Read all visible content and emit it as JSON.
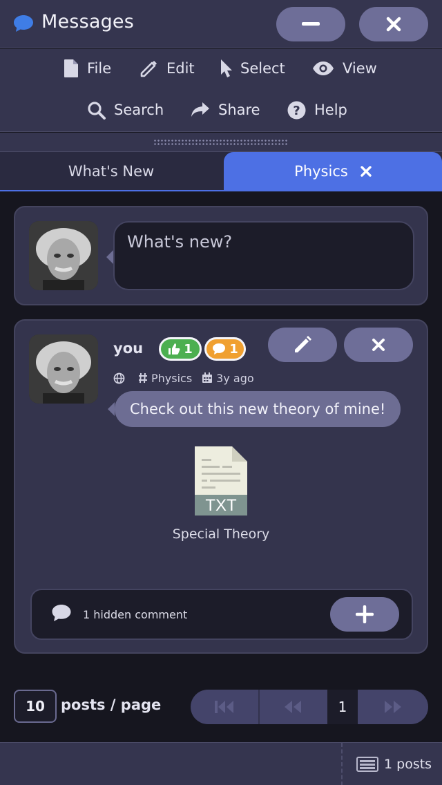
{
  "window": {
    "title": "Messages",
    "minimize_icon": "minus-icon",
    "close_icon": "close-icon"
  },
  "menu": [
    {
      "label": "File",
      "icon": "file-icon"
    },
    {
      "label": "Edit",
      "icon": "pencil-icon"
    },
    {
      "label": "Select",
      "icon": "cursor-icon"
    },
    {
      "label": "View",
      "icon": "eye-icon"
    },
    {
      "label": "Search",
      "icon": "search-icon"
    },
    {
      "label": "Share",
      "icon": "share-icon"
    },
    {
      "label": "Help",
      "icon": "help-icon"
    }
  ],
  "tabs": [
    {
      "label": "What's New",
      "active": false
    },
    {
      "label": "Physics",
      "active": true,
      "closable": true
    }
  ],
  "compose": {
    "placeholder": "What's new?"
  },
  "post": {
    "author": "you",
    "likes": "1",
    "comments_count": "1",
    "visibility_icon": "globe-icon",
    "channel": "Physics",
    "time": "3y ago",
    "message": "Check out this new theory of mine!",
    "attachment": {
      "type_label": "TXT",
      "name": "Special Theory"
    },
    "hidden_comments": "1 hidden comment"
  },
  "pagination": {
    "per_page": "10",
    "per_page_label": "posts / page",
    "current_page": "1"
  },
  "footer": {
    "count": "1 posts"
  },
  "colors": {
    "accent": "#4d70e4",
    "button": "#6e6e98",
    "like_badge": "#4caf50",
    "comment_badge": "#f0a030",
    "panel": "#35354f",
    "background": "#16161f"
  }
}
